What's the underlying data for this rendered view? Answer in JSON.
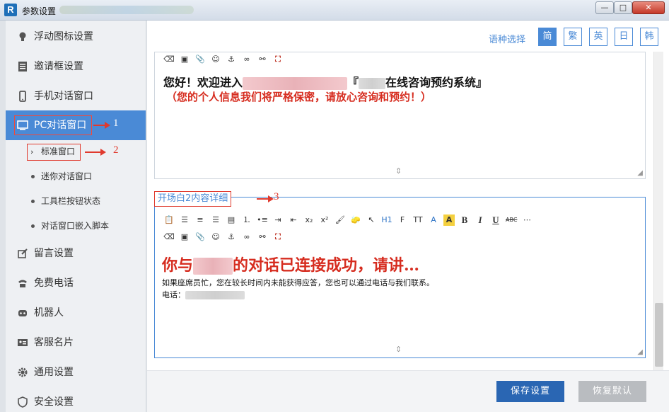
{
  "window": {
    "title": "参数设置",
    "min": "—",
    "max": "□",
    "close": "✕",
    "app_icon": "R"
  },
  "sidebar": {
    "items": [
      {
        "label": "浮动图标设置",
        "icon": "bulb-icon"
      },
      {
        "label": "邀请框设置",
        "icon": "invite-box-icon"
      },
      {
        "label": "手机对话窗口",
        "icon": "mobile-icon"
      },
      {
        "label": "PC对话窗口",
        "icon": "monitor-icon",
        "active": true
      },
      {
        "label": "留言设置",
        "icon": "edit-icon"
      },
      {
        "label": "免费电话",
        "icon": "phone-icon"
      },
      {
        "label": "机器人",
        "icon": "robot-icon"
      },
      {
        "label": "客服名片",
        "icon": "card-icon"
      },
      {
        "label": "通用设置",
        "icon": "gear-icon"
      },
      {
        "label": "安全设置",
        "icon": "shield-icon"
      }
    ],
    "sub_items": [
      {
        "label": "标准窗口",
        "selected": true
      },
      {
        "label": "迷你对话窗口"
      },
      {
        "label": "工具栏按钮状态"
      },
      {
        "label": "对话窗口嵌入脚本"
      }
    ],
    "markers": [
      "1",
      "2"
    ]
  },
  "lang": {
    "label": "语种选择",
    "options": [
      "简",
      "繁",
      "英",
      "日",
      "韩"
    ],
    "selected": "简"
  },
  "editor1": {
    "line1_prefix": "您好！欢迎进入",
    "line1_mid": "『",
    "line1_suffix": "在线咨询预约系统』",
    "line2": "（您的个人信息我们将严格保密，请放心咨询和预约！）"
  },
  "editor2": {
    "legend": "开场白2内容详细",
    "marker": "3",
    "big_prefix": "你与",
    "big_suffix": "的对话已连接成功，请讲…",
    "text1": "如果座席员忙，您在较长时间内未能获得应答，您也可以通过电话与我们联系。",
    "text2": "电话："
  },
  "toolbar": {
    "h1": "H1",
    "font_family": "F",
    "font_size": "TT",
    "font_color": "A",
    "bg_color": "A",
    "bold": "B",
    "italic": "I",
    "underline": "U",
    "strike": "ABC",
    "subscript": "x₂",
    "superscript": "x²"
  },
  "footer": {
    "save": "保存设置",
    "reset": "恢复默认"
  },
  "colors": {
    "accent": "#4a8ad6",
    "save": "#2a66b3",
    "marker": "#e03a2e",
    "text_red": "#d62c1f"
  }
}
